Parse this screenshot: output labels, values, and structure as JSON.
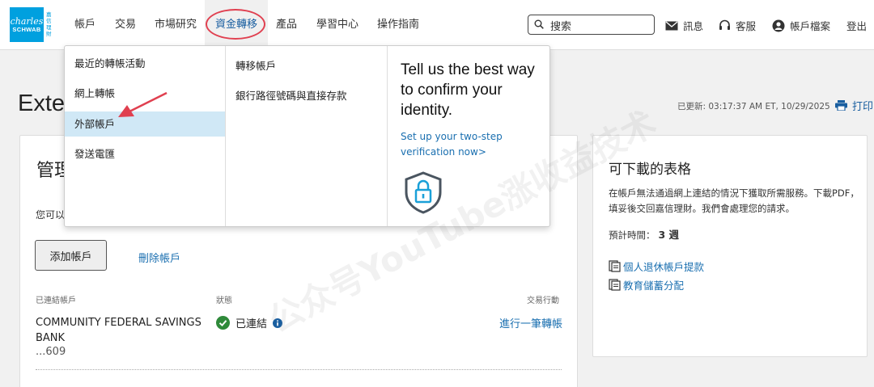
{
  "header": {
    "logo_line1": "charles",
    "logo_line2": "SCHWAB",
    "logo_cn": "嘉信理財",
    "nav": [
      {
        "label": "帳戶"
      },
      {
        "label": "交易"
      },
      {
        "label": "市場研究"
      },
      {
        "label": "資金轉移"
      },
      {
        "label": "產品"
      },
      {
        "label": "學習中心"
      },
      {
        "label": "操作指南"
      }
    ],
    "search_placeholder": "搜索",
    "messages": "訊息",
    "service": "客服",
    "profile": "帳戶檔案",
    "logout": "登出"
  },
  "page": {
    "title": "Exter",
    "updated": "已更新: 03:17:37 AM ET, 10/29/2025",
    "print": "打印"
  },
  "dropdown": {
    "col1": [
      "最近的轉帳活動",
      "網上轉帳",
      "外部帳戶",
      "發送電匯"
    ],
    "col2": [
      "轉移帳戶",
      "銀行路徑號碼與直接存款"
    ],
    "promo_title": "Tell us the best way to confirm your identity.",
    "promo_link": "Set up your two-step verification now>"
  },
  "main": {
    "title": "管理",
    "intro": "您可以",
    "add_button": "添加帳戶",
    "delete_link": "刪除帳戶",
    "col_headers": {
      "account": "已連結帳戶",
      "status": "狀態",
      "action": "交易行動"
    },
    "rows": [
      {
        "bank": "COMMUNITY FEDERAL SAVINGS BANK",
        "acct": "...609",
        "status": "已連結",
        "action": "進行一筆轉帳"
      }
    ]
  },
  "side": {
    "title": "可下載的表格",
    "desc": "在帳戶無法通過網上連結的情況下獲取所需服務。下載PDF，填妥後交回嘉信理財。我們會處理您的請求。",
    "time_label": "預計時間：",
    "time_value": "3 週",
    "links": [
      "個人退休帳戶提款",
      "教育儲蓄分配"
    ]
  },
  "watermark": "公众号YouTube涨收益技术"
}
